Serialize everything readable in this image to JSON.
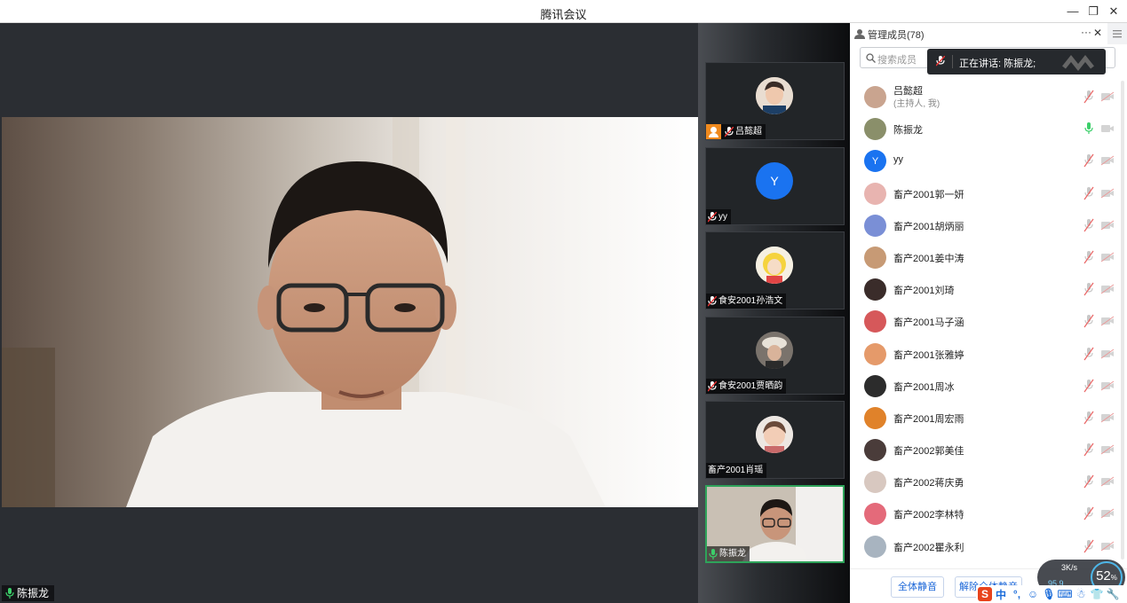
{
  "window": {
    "title": "腾讯会议",
    "minimize_icon": "—",
    "restore_icon": "❐",
    "close_icon": "✕"
  },
  "main_video": {
    "speaker_name": "陈振龙"
  },
  "gallery": {
    "tiles": [
      {
        "name": "吕懿超",
        "host": true,
        "avatar": "photo"
      },
      {
        "name": "yy",
        "host": false,
        "avatar": "Y"
      },
      {
        "name": "食安2001孙浩文",
        "host": false,
        "avatar": "photo"
      },
      {
        "name": "食安2001贾晒韵",
        "host": false,
        "avatar": "photo"
      },
      {
        "name": "畜产2001肖瑶",
        "host": false,
        "avatar": "photo"
      },
      {
        "name": "陈振龙",
        "host": false,
        "avatar": "video"
      }
    ]
  },
  "panel": {
    "title": "管理成员(78)",
    "more_icon": "···",
    "close_icon": "✕",
    "search_placeholder": "搜索成员",
    "speaking_toast": "正在讲话: 陈振龙;",
    "members": [
      {
        "name": "吕懿超",
        "sub": "(主持人, 我)",
        "mic": "muted",
        "avatar_color": "#c9a48f"
      },
      {
        "name": "陈振龙",
        "sub": "",
        "mic": "on",
        "avatar_color": "#8a8f6a"
      },
      {
        "name": "yy",
        "sub": "",
        "mic": "muted",
        "avatar_color": "#1a73f0",
        "letter": "Y"
      },
      {
        "name": "畜产2001郭一妍",
        "sub": "",
        "mic": "muted",
        "avatar_color": "#e8b4b0"
      },
      {
        "name": "畜产2001胡炳丽",
        "sub": "",
        "mic": "muted",
        "avatar_color": "#7a8fd6"
      },
      {
        "name": "畜产2001姜中涛",
        "sub": "",
        "mic": "muted",
        "avatar_color": "#c79a75"
      },
      {
        "name": "畜产2001刘琦",
        "sub": "",
        "mic": "muted",
        "avatar_color": "#3a2c2a"
      },
      {
        "name": "畜产2001马子涵",
        "sub": "",
        "mic": "muted",
        "avatar_color": "#d6585a"
      },
      {
        "name": "畜产2001张雅婷",
        "sub": "",
        "mic": "muted",
        "avatar_color": "#e59a6a"
      },
      {
        "name": "畜产2001周冰",
        "sub": "",
        "mic": "muted",
        "avatar_color": "#2c2c2c"
      },
      {
        "name": "畜产2001周宏雨",
        "sub": "",
        "mic": "muted",
        "avatar_color": "#e0822a"
      },
      {
        "name": "畜产2002郭美佳",
        "sub": "",
        "mic": "muted",
        "avatar_color": "#4a3c3a"
      },
      {
        "name": "畜产2002蒋庆勇",
        "sub": "",
        "mic": "muted",
        "avatar_color": "#d8c8c0"
      },
      {
        "name": "畜产2002李林特",
        "sub": "",
        "mic": "muted",
        "avatar_color": "#e46a7a"
      },
      {
        "name": "畜产2002瞿永利",
        "sub": "",
        "mic": "muted",
        "avatar_color": "#a8b4c0"
      }
    ],
    "mute_all_label": "全体静音",
    "unmute_all_label": "解除全体静音"
  },
  "net_widget": {
    "upload": "3K/s",
    "download": "95.9",
    "percent": "52",
    "percent_unit": "%"
  },
  "ime": {
    "mode": "中"
  }
}
